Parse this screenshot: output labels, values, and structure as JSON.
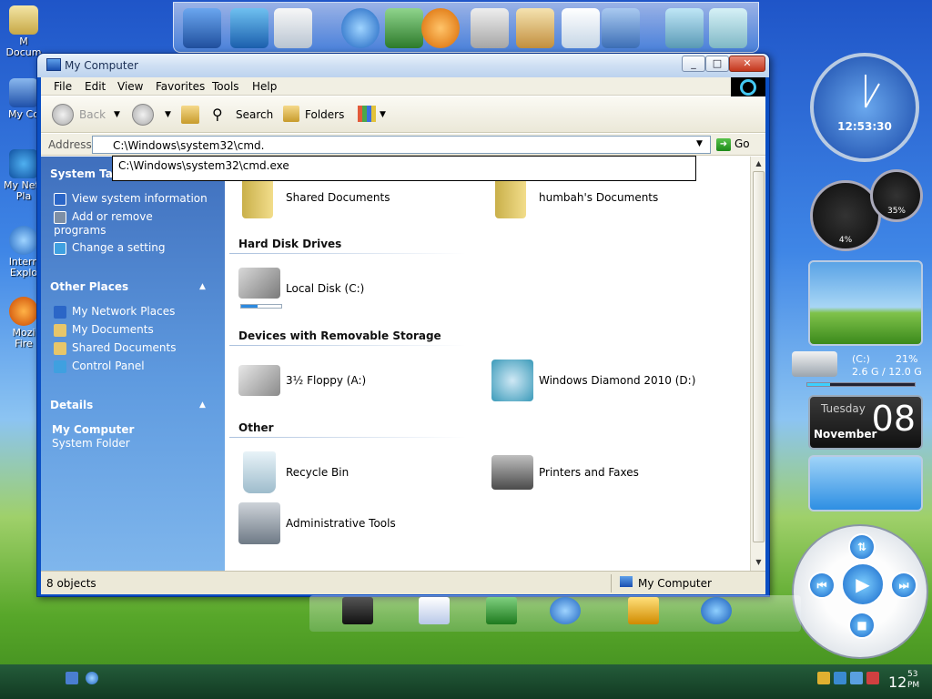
{
  "desktop": {
    "icons": [
      {
        "label": "M\nDocum"
      },
      {
        "label": "My Co"
      },
      {
        "label": "My Netw\nPla"
      },
      {
        "label": "Intern\nExplo"
      },
      {
        "label": "Mozi\nFire"
      }
    ]
  },
  "window": {
    "title": "My Computer",
    "controls": {
      "minimize": "_",
      "maximize": "□",
      "close": "✕"
    }
  },
  "menubar": {
    "items": [
      "File",
      "Edit",
      "View",
      "Favorites",
      "Tools",
      "Help"
    ]
  },
  "toolbar": {
    "back_label": "Back",
    "search_label": "Search",
    "folders_label": "Folders"
  },
  "address": {
    "label": "Address",
    "value": "C:\\Windows\\system32\\cmd.",
    "go_label": "Go",
    "autocomplete": "C:\\Windows\\system32\\cmd.exe"
  },
  "taskpane": {
    "system_tasks": {
      "title": "System Tas",
      "items": [
        "View system information",
        "Add or remove\nprograms",
        "Change a setting"
      ]
    },
    "other_places": {
      "title": "Other Places",
      "items": [
        "My Network Places",
        "My Documents",
        "Shared Documents",
        "Control Panel"
      ]
    },
    "details": {
      "title": "Details",
      "name": "My Computer",
      "type": "System Folder"
    }
  },
  "content": {
    "folders": [
      {
        "label": "Shared Documents"
      },
      {
        "label": "humbah's Documents"
      }
    ],
    "groups": [
      {
        "title": "Hard Disk Drives",
        "items": [
          {
            "label": "Local Disk (C:)"
          }
        ]
      },
      {
        "title": "Devices with Removable Storage",
        "items": [
          {
            "label": "3½ Floppy (A:)"
          },
          {
            "label": "Windows Diamond 2010 (D:)"
          }
        ]
      },
      {
        "title": "Other",
        "items": [
          {
            "label": "Recycle Bin"
          },
          {
            "label": "Printers and Faxes"
          },
          {
            "label": "Administrative Tools"
          }
        ]
      }
    ]
  },
  "statusbar": {
    "count": "8 objects",
    "location": "My Computer"
  },
  "gadgets": {
    "clock_time": "12:53:30",
    "cpu_gauge": "4%",
    "mem_gauge": "35%",
    "drive_label": "(C:)",
    "drive_space": "2.6 G / 12.0 G",
    "drive_percent": "21%",
    "drive_usage": 0.21,
    "calendar_day": "Tuesday",
    "calendar_month": "November",
    "calendar_date": "08"
  },
  "taskbar": {
    "clock_hour": "12",
    "clock_minute": "53",
    "clock_ampm": "PM"
  },
  "colors": {
    "taskpane_blue": "#3f6fbd",
    "window_frame": "#0b4fc4",
    "link_white": "#ffffff"
  }
}
